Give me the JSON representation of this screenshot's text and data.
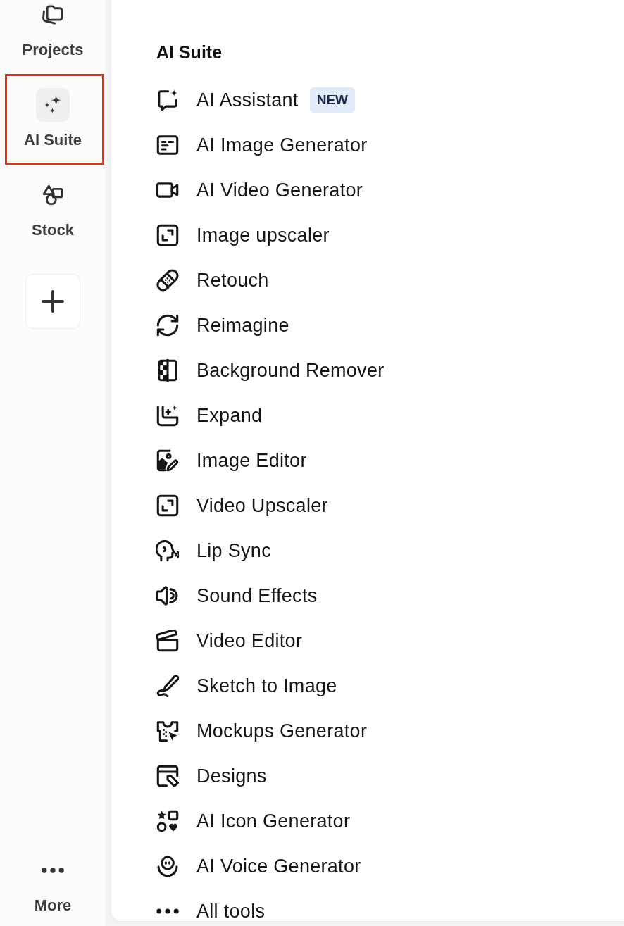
{
  "sidebar": {
    "items": [
      {
        "label": "Projects",
        "selected": false,
        "highlighted": false
      },
      {
        "label": "AI Suite",
        "selected": true,
        "highlighted": true
      },
      {
        "label": "Stock",
        "selected": false,
        "highlighted": false
      }
    ],
    "more": {
      "label": "More"
    }
  },
  "panel": {
    "title": "AI Suite",
    "items": [
      {
        "label": "AI Assistant",
        "badge": "NEW"
      },
      {
        "label": "AI Image Generator"
      },
      {
        "label": "AI Video Generator"
      },
      {
        "label": "Image upscaler"
      },
      {
        "label": "Retouch"
      },
      {
        "label": "Reimagine"
      },
      {
        "label": "Background Remover"
      },
      {
        "label": "Expand"
      },
      {
        "label": "Image Editor"
      },
      {
        "label": "Video Upscaler"
      },
      {
        "label": "Lip Sync"
      },
      {
        "label": "Sound Effects"
      },
      {
        "label": "Video Editor"
      },
      {
        "label": "Sketch to Image"
      },
      {
        "label": "Mockups Generator"
      },
      {
        "label": "Designs"
      },
      {
        "label": "AI Icon Generator"
      },
      {
        "label": "AI Voice Generator"
      },
      {
        "label": "All tools"
      }
    ]
  }
}
